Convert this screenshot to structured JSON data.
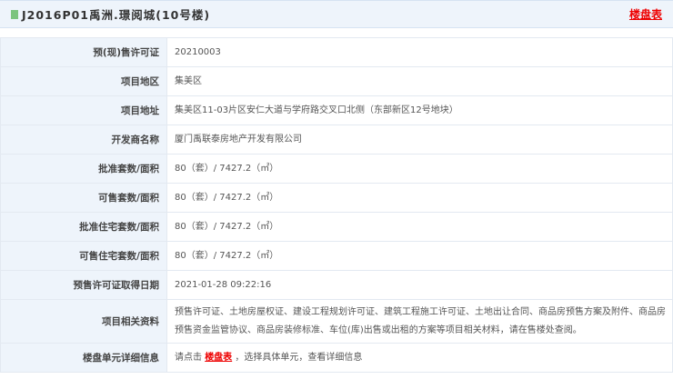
{
  "header": {
    "title": "J2016P01禹洲.璟阅城(10号楼)",
    "link": "楼盘表",
    "icon": "document-icon"
  },
  "rows": [
    {
      "label": "预(现)售许可证",
      "value": "20210003"
    },
    {
      "label": "项目地区",
      "value": "集美区"
    },
    {
      "label": "项目地址",
      "value": "集美区11-03片区安仁大道与学府路交叉口北侧（东部新区12号地块）"
    },
    {
      "label": "开发商名称",
      "value": "厦门禹联泰房地产开发有限公司"
    },
    {
      "label": "批准套数/面积",
      "value": "80（套）/ 7427.2（㎡）"
    },
    {
      "label": "可售套数/面积",
      "value": "80（套）/ 7427.2（㎡）"
    },
    {
      "label": "批准住宅套数/面积",
      "value": "80（套）/ 7427.2（㎡）"
    },
    {
      "label": "可售住宅套数/面积",
      "value": "80（套）/ 7427.2（㎡）"
    },
    {
      "label": "预售许可证取得日期",
      "value": "2021-01-28 09:22:16"
    },
    {
      "label": "项目相关资料",
      "value": "预售许可证、土地房屋权证、建设工程规划许可证、建筑工程施工许可证、土地出让合同、商品房预售方案及附件、商品房预售资金监管协议、商品房装修标准、车位(库)出售或出租的方案等项目相关材料，请在售楼处查阅。"
    }
  ],
  "detail": {
    "label": "楼盘单元详细信息",
    "prefix": "请点击",
    "link": "楼盘表",
    "suffix": "，选择具体单元，查看详细信息"
  }
}
